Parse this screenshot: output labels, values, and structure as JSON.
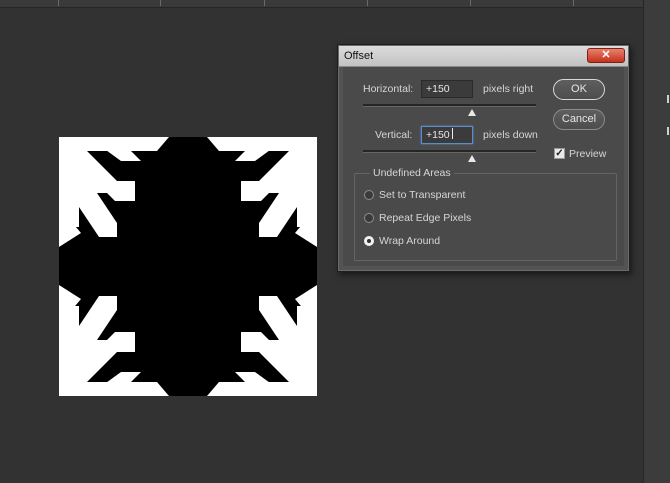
{
  "dialog": {
    "title": "Offset",
    "close_glyph": "✕",
    "horizontal": {
      "label": "Horizontal:",
      "value": "+150",
      "unit": "pixels right"
    },
    "vertical": {
      "label": "Vertical:",
      "value": "+150",
      "unit": "pixels down"
    },
    "buttons": {
      "ok": "OK",
      "cancel": "Cancel"
    },
    "preview": {
      "label": "Preview",
      "checked": true,
      "check_glyph": "✓"
    },
    "undefined_areas": {
      "title": "Undefined Areas",
      "options": [
        {
          "label": "Set to Transparent",
          "selected": false
        },
        {
          "label": "Repeat Edge Pixels",
          "selected": false
        },
        {
          "label": "Wrap Around",
          "selected": true
        }
      ]
    }
  },
  "colors": {
    "workspace": "#323232",
    "dialog_bg": "#535353",
    "close_button": "#c4321c",
    "image_black": "#000000",
    "image_white": "#ffffff"
  },
  "icons": [
    "close-icon",
    "checkbox-check-icon",
    "radio-icon",
    "slider-thumb-icon"
  ]
}
